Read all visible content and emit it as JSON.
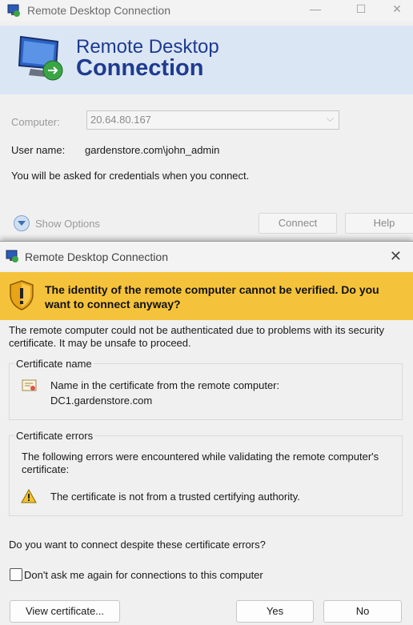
{
  "main_window": {
    "title": "Remote Desktop Connection",
    "banner_line1": "Remote Desktop",
    "banner_line2": "Connection",
    "computer_label": "Computer:",
    "computer_value": "20.64.80.167",
    "username_label": "User name:",
    "username_value": "gardenstore.com\\john_admin",
    "credentials_note": "You will be asked for credentials when you connect.",
    "show_options": "Show Options",
    "connect_button": "Connect",
    "help_button": "Help"
  },
  "dialog": {
    "title": "Remote Desktop Connection",
    "warning_heading": "The identity of the remote computer cannot be verified. Do you want to connect anyway?",
    "description": "The remote computer could not be authenticated due to problems with its security certificate. It may be unsafe to proceed.",
    "cert_name_group": "Certificate name",
    "cert_name_label": "Name in the certificate from the remote computer:",
    "cert_name_value": "DC1.gardenstore.com",
    "cert_errors_group": "Certificate errors",
    "cert_errors_intro": "The following errors were encountered while validating the remote computer's certificate:",
    "cert_error_item": "The certificate is not from a trusted certifying authority.",
    "question": "Do you want to connect despite these certificate errors?",
    "dont_ask": "Don't ask me again for connections to this computer",
    "view_certificate": "View certificate...",
    "yes": "Yes",
    "no": "No"
  },
  "colors": {
    "warning_band": "#f5c33b",
    "banner": "#dbe6f5",
    "brand_text": "#1f3b8f"
  },
  "icons": [
    "rdc-app-icon",
    "rdc-logo-icon",
    "warning-shield-icon",
    "certificate-icon",
    "warning-triangle-icon",
    "close-icon",
    "chevron-down-icon"
  ]
}
